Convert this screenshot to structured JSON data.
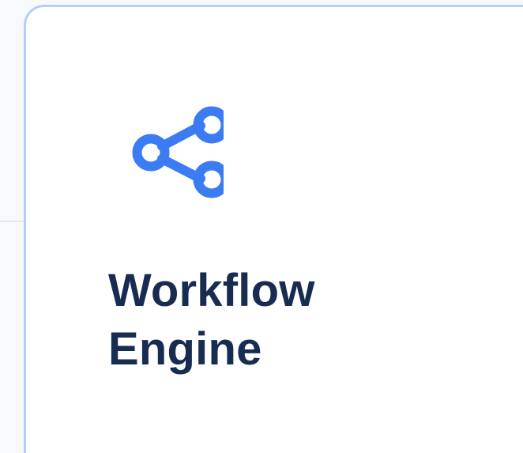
{
  "card": {
    "icon": "share-nodes-icon",
    "title_line1": "Workflow",
    "title_line2": "Engine"
  },
  "colors": {
    "accent": "#3b7cf3",
    "title": "#182c51",
    "card_border": "#b5cdfb",
    "card_background": "#ffffff",
    "page_background": "#f7f9fd"
  }
}
